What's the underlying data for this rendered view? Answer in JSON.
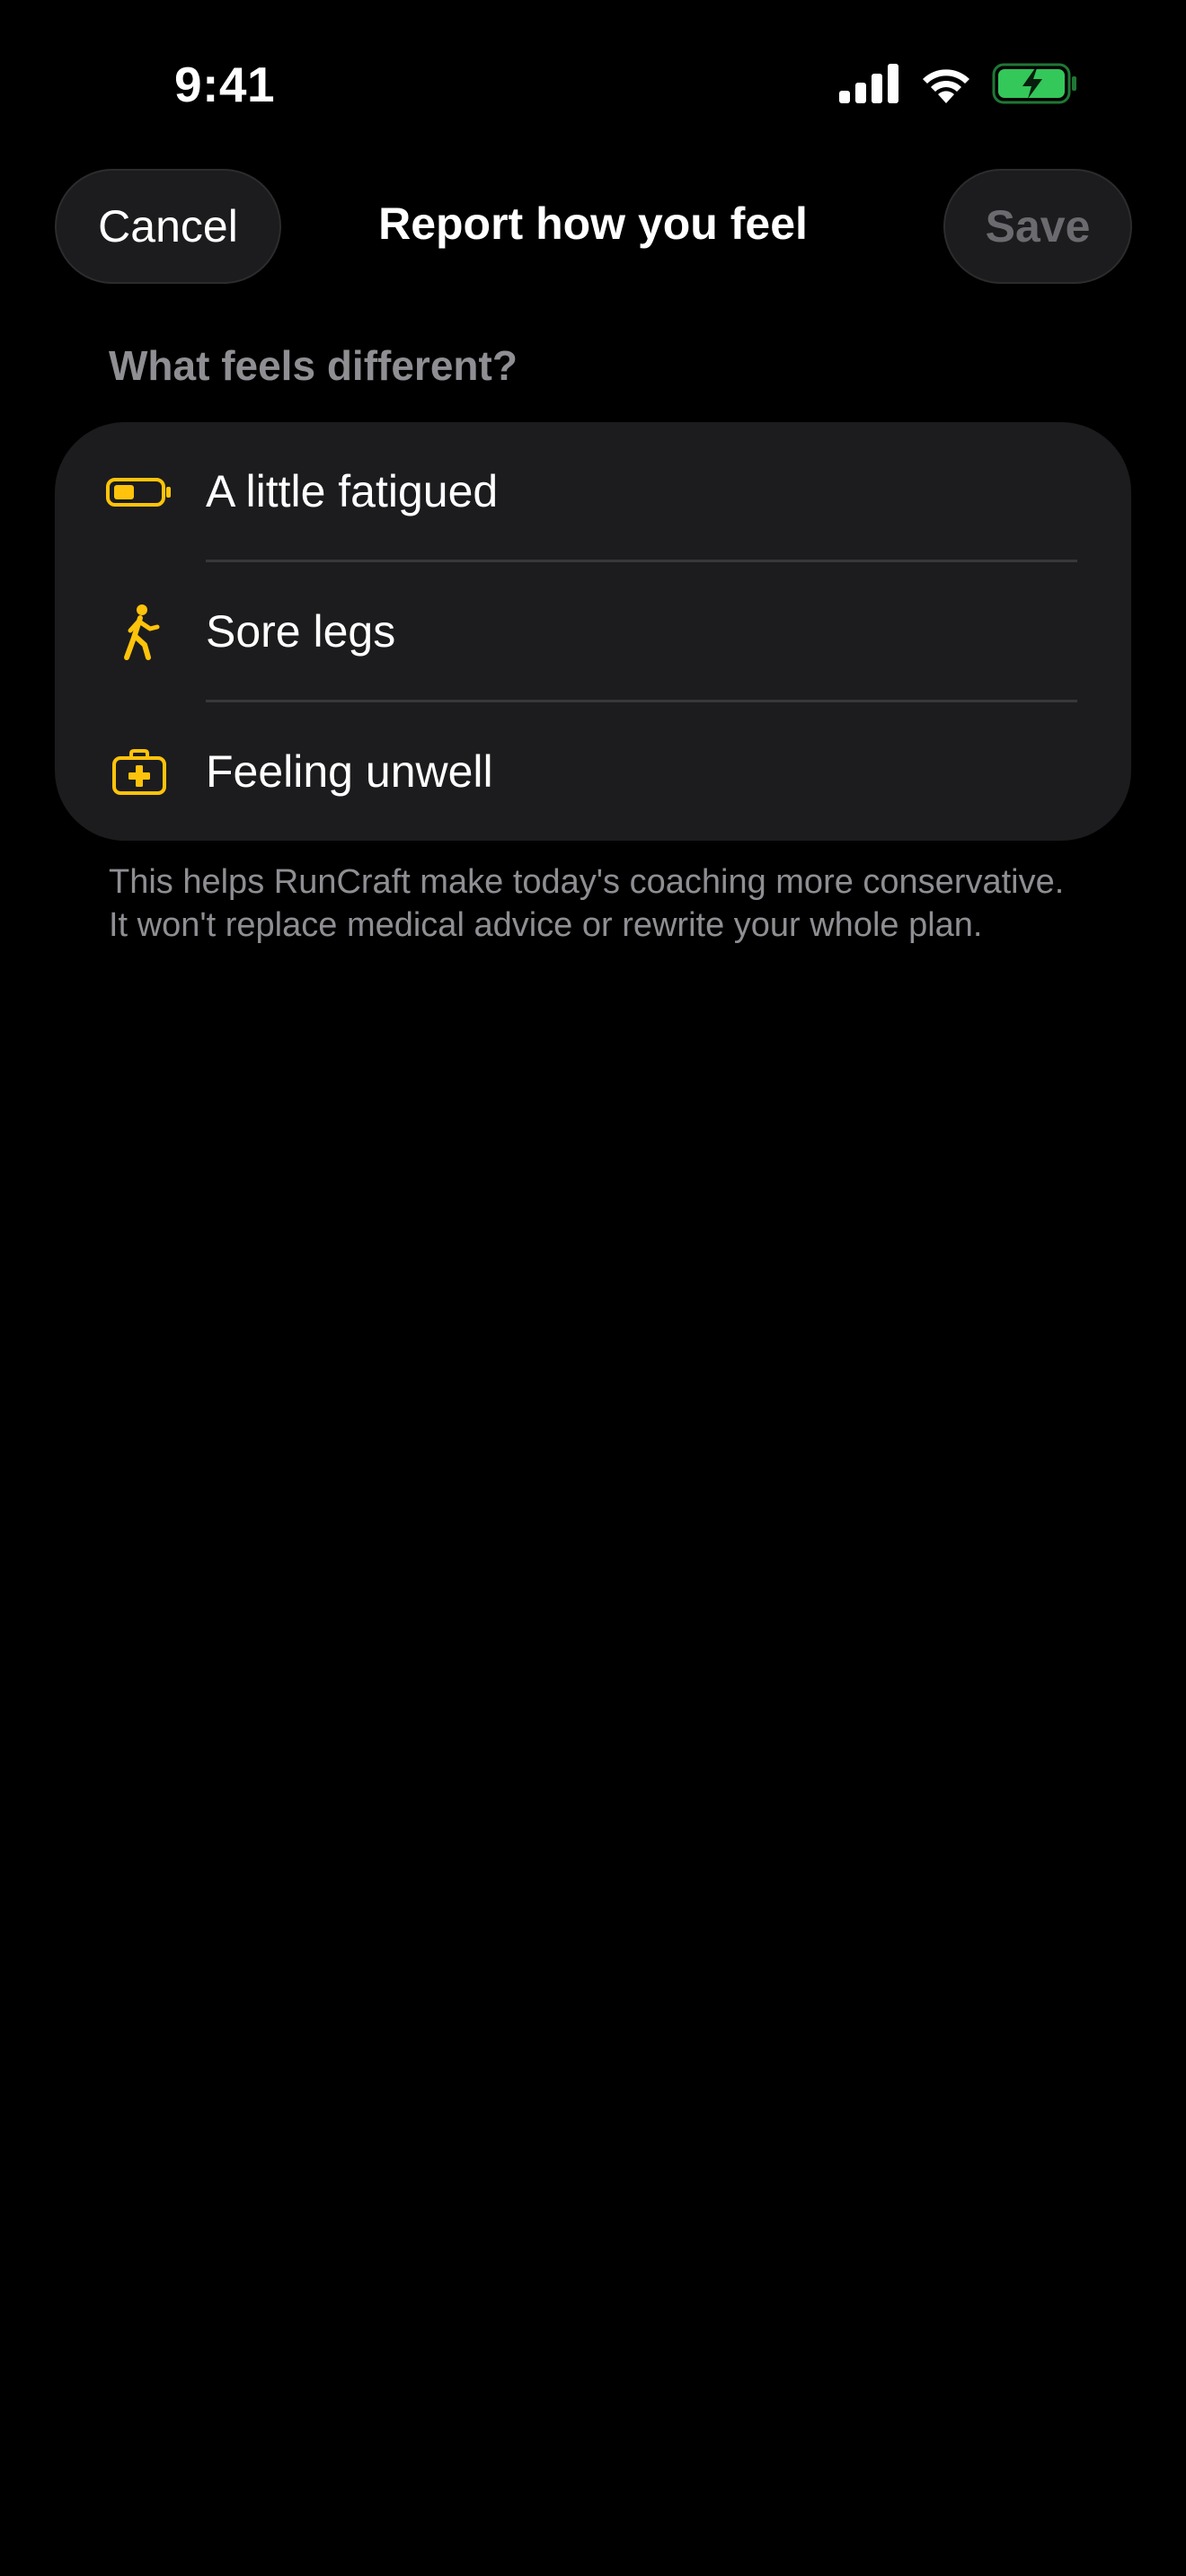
{
  "status_bar": {
    "time": "9:41",
    "icons": [
      "cellular-signal-icon",
      "wifi-icon",
      "battery-charging-icon"
    ],
    "battery_color": "#34c759"
  },
  "nav": {
    "cancel_label": "Cancel",
    "title": "Report how you feel",
    "save_label": "Save"
  },
  "section": {
    "header": "What feels different?"
  },
  "options": [
    {
      "label": "A little fatigued",
      "icon": "battery-low-icon"
    },
    {
      "label": "Sore legs",
      "icon": "walking-figure-icon"
    },
    {
      "label": "Feeling unwell",
      "icon": "medical-kit-icon"
    }
  ],
  "footer": {
    "note": "This helps RunCraft make today's coaching more conservative. It won't replace medical advice or rewrite your whole plan."
  },
  "colors": {
    "background": "#000000",
    "card": "#1c1c1e",
    "accent": "#ffc30b",
    "secondary_text": "#8e8e93",
    "disabled_text": "#6b6b6f"
  }
}
